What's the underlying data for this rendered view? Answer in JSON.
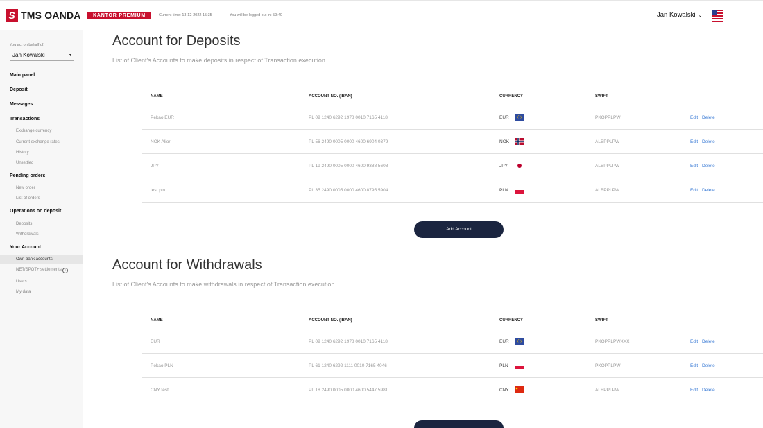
{
  "header": {
    "logo_mark": "S",
    "logo_text": "TMS OANDA",
    "badge": "KANTOR PREMIUM",
    "current_time": "Current time: 13-12-2022 15:35",
    "logout_info": "You will be logged out in: 59:40",
    "user_name": "Jan Kowalski",
    "user_chevron": "⌄"
  },
  "sidebar": {
    "on_behalf_label": "You act on behalf of:",
    "on_behalf_value": "Jan Kowalski",
    "nav": {
      "main_panel": "Main panel",
      "deposit": "Deposit",
      "messages": "Messages",
      "transactions": "Transactions",
      "exchange_currency": "Exchange currency",
      "current_rates": "Current exchange rates",
      "history": "History",
      "unsettled": "Unsettled",
      "pending_orders": "Pending orders",
      "new_order": "New order",
      "list_of_orders": "List of orders",
      "operations_on_deposit": "Operations on deposit",
      "deposits": "Deposits",
      "withdrawals": "Withdrawals",
      "your_account": "Your Account",
      "own_bank_accounts": "Own bank accounts",
      "net_spot_settlements": "NET/SPOT+ settlements",
      "users": "Users",
      "my_data": "My data"
    }
  },
  "deposits": {
    "title": "Account for Deposits",
    "subtitle": "List of Client's Accounts to make deposits in respect of Transaction execution",
    "columns": {
      "name": "NAME",
      "account": "ACCOUNT NO. (IBAN)",
      "currency": "CURRENCY",
      "swift": "SWIFT"
    },
    "rows": [
      {
        "name": "Pekao EUR",
        "iban": "PL 09 1240 6292 1978 0010 7165 4118",
        "currency": "EUR",
        "flag": "eu-flag",
        "swift": "PKOPPLPW",
        "edit": "Edit",
        "delete": "Delete"
      },
      {
        "name": "NOK Alior",
        "iban": "PL 56 2490 0005 0000 4600 6904 0379",
        "currency": "NOK",
        "flag": "no-flag",
        "swift": "ALBPPLPW",
        "edit": "Edit",
        "delete": "Delete"
      },
      {
        "name": "JPY",
        "iban": "PL 19 2490 0005 0000 4600 9388 5608",
        "currency": "JPY",
        "flag": "jp-flag",
        "swift": "ALBPPLPW",
        "edit": "Edit",
        "delete": "Delete"
      },
      {
        "name": "test pln",
        "iban": "PL 35 2490 0005 0000 4600 8795 5904",
        "currency": "PLN",
        "flag": "pl-flag",
        "swift": "ALBPPLPW",
        "edit": "Edit",
        "delete": "Delete"
      }
    ],
    "add_button": "Add Account"
  },
  "withdrawals": {
    "title": "Account for Withdrawals",
    "subtitle": "List of Client's Accounts to make withdrawals in respect of Transaction execution",
    "columns": {
      "name": "NAME",
      "account": "ACCOUNT NO. (IBAN)",
      "currency": "CURRENCY",
      "swift": "SWIFT"
    },
    "rows": [
      {
        "name": "EUR",
        "iban": "PL 09 1240 6292 1978 0010 7165 4118",
        "currency": "EUR",
        "flag": "eu-flag",
        "swift": "PKOPPLPWXXX",
        "edit": "Edit",
        "delete": "Delete"
      },
      {
        "name": "Pekao PLN",
        "iban": "PL 61 1240 6292 1111 0010 7165 4046",
        "currency": "PLN",
        "flag": "pl-flag",
        "swift": "PKOPPLPW",
        "edit": "Edit",
        "delete": "Delete"
      },
      {
        "name": "CNY test",
        "iban": "PL 18 2490 0005 0000 4600 5447 5981",
        "currency": "CNY",
        "flag": "cn-flag",
        "swift": "ALBPPLPW",
        "edit": "Edit",
        "delete": "Delete"
      }
    ]
  },
  "colors": {
    "brand_red": "#c8102e",
    "navy": "#1b2540",
    "link_blue": "#3a7bd5"
  }
}
